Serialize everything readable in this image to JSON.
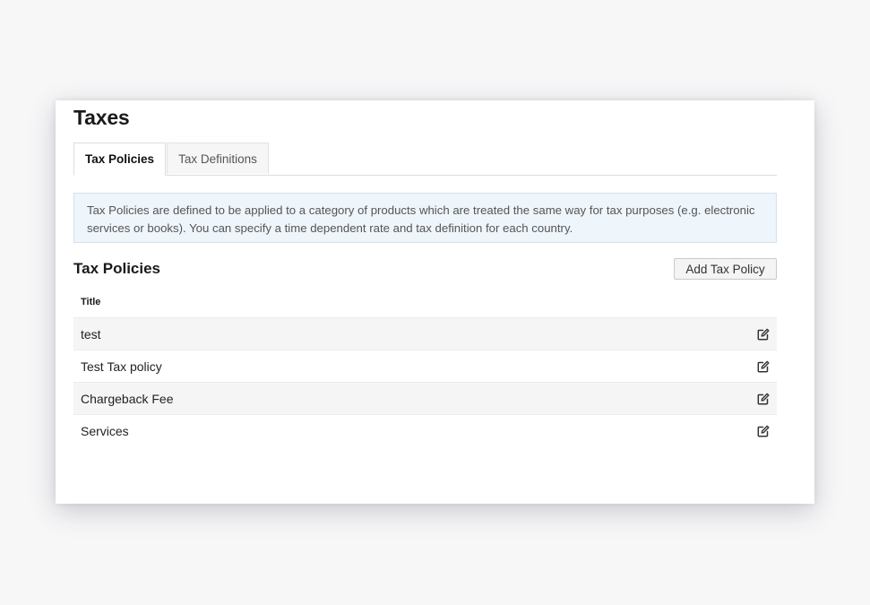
{
  "header": {
    "title": "Taxes"
  },
  "tabs": [
    {
      "label": "Tax Policies",
      "active": true
    },
    {
      "label": "Tax Definitions",
      "active": false
    }
  ],
  "info_text": "Tax Policies are defined to be applied to a category of products which are treated the same way for tax purposes (e.g. electronic services or books). You can specify a time dependent rate and tax definition for each country.",
  "section": {
    "title": "Tax Policies",
    "add_button_label": "Add Tax Policy"
  },
  "table": {
    "columns": [
      "Title"
    ],
    "rows": [
      {
        "title": "test",
        "action_icon": "edit-icon"
      },
      {
        "title": "Test Tax policy",
        "action_icon": "edit-icon"
      },
      {
        "title": "Chargeback Fee",
        "action_icon": "edit-icon"
      },
      {
        "title": "Services",
        "action_icon": "edit-icon"
      }
    ]
  },
  "colors": {
    "info_background": "#eef5fb",
    "info_border": "#d4e2ee",
    "row_stripe": "#f5f5f5"
  }
}
